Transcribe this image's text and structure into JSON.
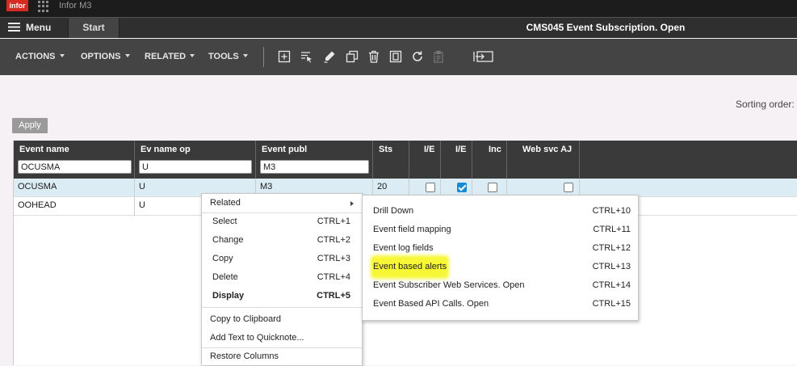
{
  "topbar": {
    "logo": "infor",
    "app_name": "Infor M3"
  },
  "menubar": {
    "menu_label": "Menu",
    "start_tab": "Start",
    "panel_title": "CMS045 Event Subscription. Open"
  },
  "toolbar": {
    "menus": [
      "ACTIONS",
      "OPTIONS",
      "RELATED",
      "TOOLS"
    ],
    "icons": [
      "add-icon",
      "select-icon",
      "edit-icon",
      "copy-icon",
      "delete-icon",
      "display-icon",
      "refresh-icon",
      "clipboard-icon",
      "export-icon"
    ]
  },
  "sorting": {
    "label": "Sorting order:"
  },
  "apply_button": "Apply",
  "grid": {
    "columns": [
      "Event name",
      "Ev name op",
      "Event publ",
      "Sts",
      "I/E",
      "I/E",
      "Inc",
      "Web svc AJ"
    ],
    "filters": {
      "event_name": "OCUSMA",
      "ev_name_op": "U",
      "event_publ": "M3"
    },
    "rows": [
      {
        "event_name": "OCUSMA",
        "ev_name_op": "U",
        "event_publ": "M3",
        "sts": "20",
        "ie1": false,
        "ie2": true,
        "inc": false,
        "websvc": false
      },
      {
        "event_name": "OOHEAD",
        "ev_name_op": "U"
      }
    ]
  },
  "context_menu": {
    "related": "Related",
    "items": [
      {
        "label": "Select",
        "shortcut": "CTRL+1"
      },
      {
        "label": "Change",
        "shortcut": "CTRL+2"
      },
      {
        "label": "Copy",
        "shortcut": "CTRL+3"
      },
      {
        "label": "Delete",
        "shortcut": "CTRL+4"
      },
      {
        "label": "Display",
        "shortcut": "CTRL+5"
      }
    ],
    "extra": [
      "Copy to Clipboard",
      "Add Text to Quicknote...",
      "Restore Columns"
    ]
  },
  "submenu": {
    "items": [
      {
        "label": "Drill Down",
        "shortcut": "CTRL+10"
      },
      {
        "label": "Event field mapping",
        "shortcut": "CTRL+11"
      },
      {
        "label": "Event log fields",
        "shortcut": "CTRL+12"
      },
      {
        "label": "Event based alerts",
        "shortcut": "CTRL+13"
      },
      {
        "label": "Event Subscriber Web Services. Open",
        "shortcut": "CTRL+14"
      },
      {
        "label": "Event Based API Calls. Open",
        "shortcut": "CTRL+15"
      }
    ]
  },
  "colors": {
    "highlight": "#f7f737",
    "logo": "#d62b21",
    "checkbox_checked": "#1a8ad4"
  }
}
